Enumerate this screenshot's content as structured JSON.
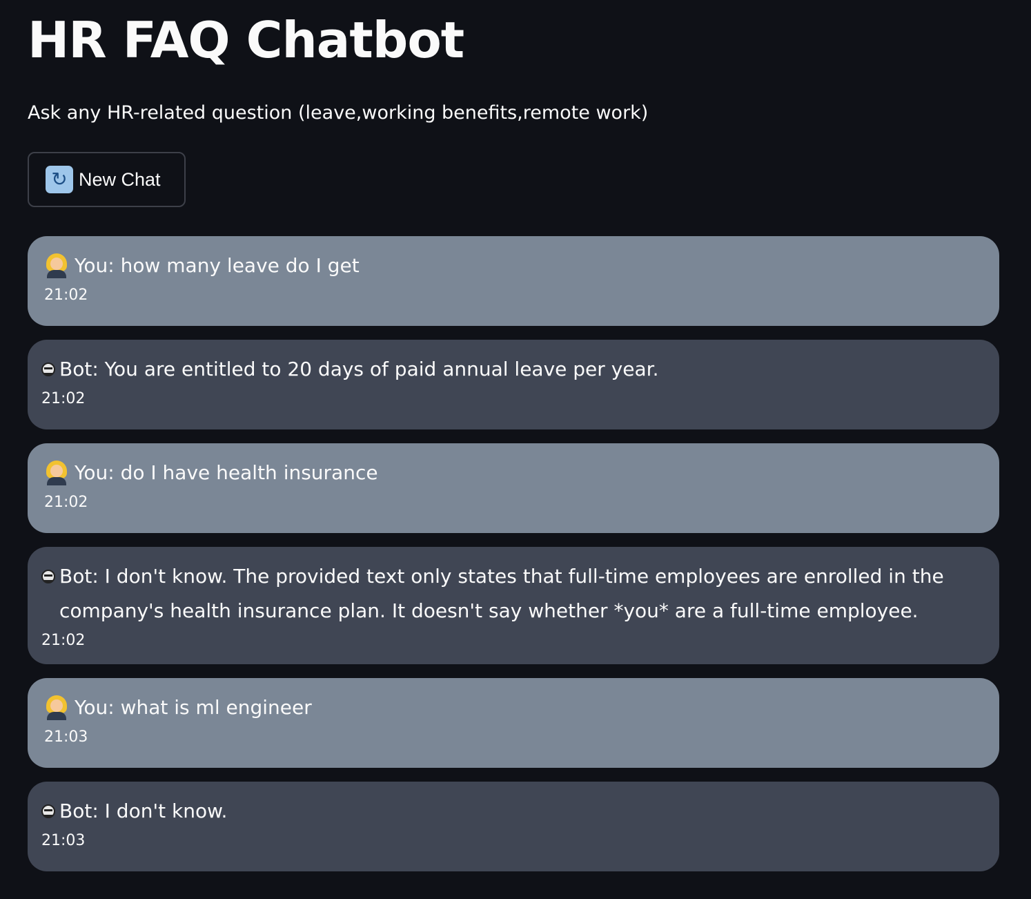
{
  "header": {
    "title": "HR FAQ Chatbot",
    "subtitle": "Ask any HR-related question (leave,working benefits,remote work)"
  },
  "new_chat_button": {
    "icon": "refresh-icon",
    "label": "New Chat"
  },
  "messages": [
    {
      "role": "user",
      "icon": "woman-office-worker-icon",
      "text": "You: how many leave do I get",
      "time": "21:02"
    },
    {
      "role": "bot",
      "icon": "robot-icon",
      "text": "Bot: You are entitled to 20 days of paid annual leave per year.",
      "time": "21:02"
    },
    {
      "role": "user",
      "icon": "woman-office-worker-icon",
      "text": "You: do I have health insurance",
      "time": "21:02"
    },
    {
      "role": "bot",
      "icon": "robot-icon",
      "text": "Bot: I don't know. The provided text only states that full-time employees are enrolled in the company's health insurance plan. It doesn't say whether *you* are a full-time employee.",
      "time": "21:02"
    },
    {
      "role": "user",
      "icon": "woman-office-worker-icon",
      "text": "You: what is ml engineer",
      "time": "21:03"
    },
    {
      "role": "bot",
      "icon": "robot-icon",
      "text": "Bot: I don't know.",
      "time": "21:03"
    }
  ],
  "colors": {
    "background": "#0f1117",
    "user_bubble": "#7b8796",
    "bot_bubble": "#404654",
    "text": "#fafafa"
  }
}
